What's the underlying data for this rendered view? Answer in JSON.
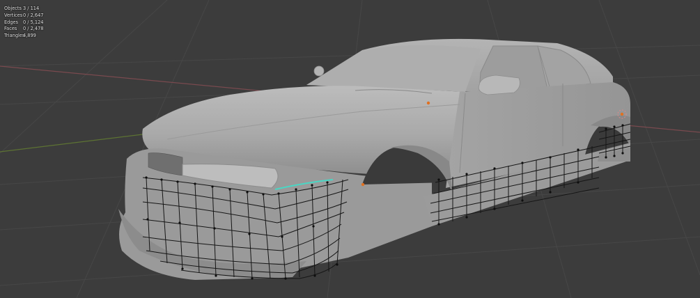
{
  "viewport": {
    "stats": [
      {
        "label": "Objects",
        "value": "3 / 114"
      },
      {
        "label": "Vertices",
        "value": "0 / 2,647"
      },
      {
        "label": "Edges",
        "value": "0 / 5,124"
      },
      {
        "label": "Faces",
        "value": "0 / 2,478"
      },
      {
        "label": "Triangles",
        "value": "4,899"
      }
    ]
  },
  "colors": {
    "background": "#3c3c3c",
    "grid": "#454545",
    "x_axis": "#7a4a4f",
    "y_axis": "#5d7333",
    "car_body": "#a8a8a8",
    "wire": "#151515",
    "selected_edge": "#4ad6c4",
    "origin": "#e07020"
  },
  "icons": {
    "origin_marker": "origin-dot-icon",
    "light_gizmo": "light-gizmo-icon"
  }
}
